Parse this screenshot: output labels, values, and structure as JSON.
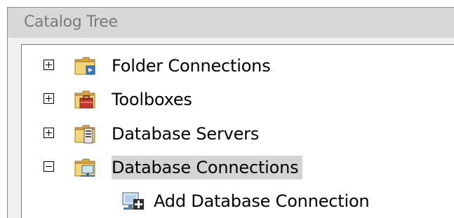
{
  "panel": {
    "title": "Catalog Tree"
  },
  "tree": {
    "items": [
      {
        "label": "Folder Connections",
        "expander": "plus",
        "icon": "folder-connections-icon"
      },
      {
        "label": "Toolboxes",
        "expander": "plus",
        "icon": "toolbox-icon"
      },
      {
        "label": "Database Servers",
        "expander": "plus",
        "icon": "database-servers-icon"
      },
      {
        "label": "Database Connections",
        "expander": "minus",
        "icon": "database-connections-icon",
        "selected": true
      },
      {
        "label": "Add Database Connection",
        "icon": "add-database-connection-icon",
        "child": true
      }
    ]
  },
  "colors": {
    "folder": "#e8c35a",
    "selection": "#d4d4d4",
    "title_text": "#7a7a7a"
  }
}
